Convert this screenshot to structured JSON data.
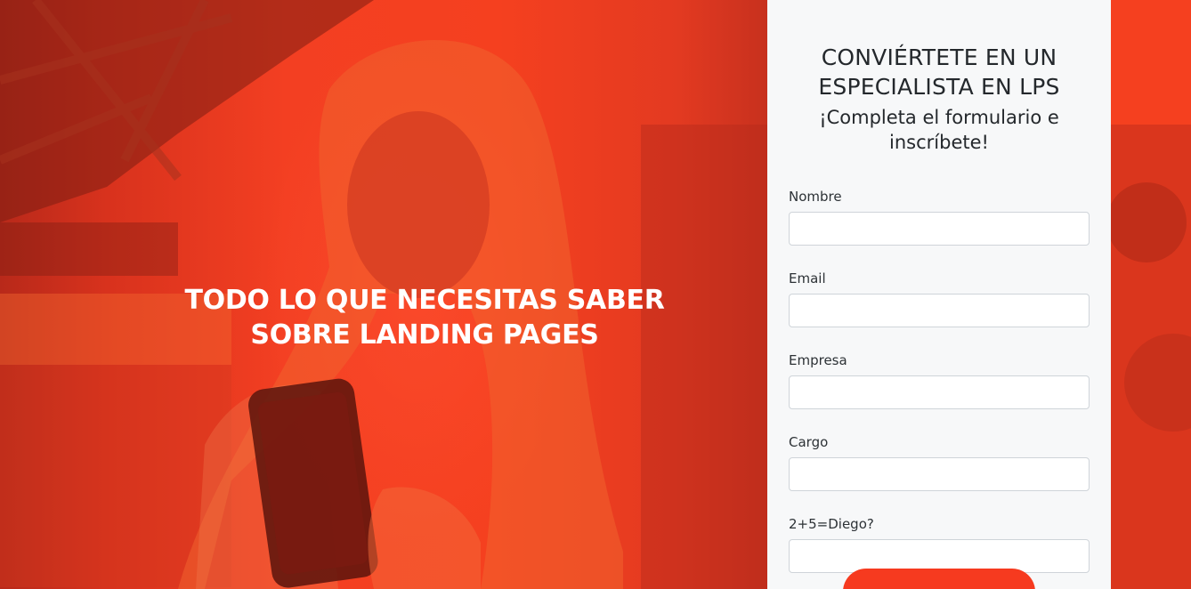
{
  "hero": {
    "title_line1": "TODO LO QUE NECESITAS SABER",
    "title_line2": "SOBRE LANDING PAGES"
  },
  "form": {
    "title_line1": "CONVIÉRTETE EN UN",
    "title_line2": "ESPECIALISTA EN LPS",
    "subtitle_line1": "¡Completa el formulario e",
    "subtitle_line2": "inscríbete!",
    "fields": [
      {
        "label": "Nombre",
        "value": ""
      },
      {
        "label": "Email",
        "value": ""
      },
      {
        "label": "Empresa",
        "value": ""
      },
      {
        "label": "Cargo",
        "value": ""
      },
      {
        "label": "2+5=Diego?",
        "value": ""
      }
    ],
    "submit_label": ""
  },
  "colors": {
    "accent": "#f63f24",
    "panel": "#f7f8f9",
    "text_dark": "#24282c",
    "white": "#ffffff"
  }
}
